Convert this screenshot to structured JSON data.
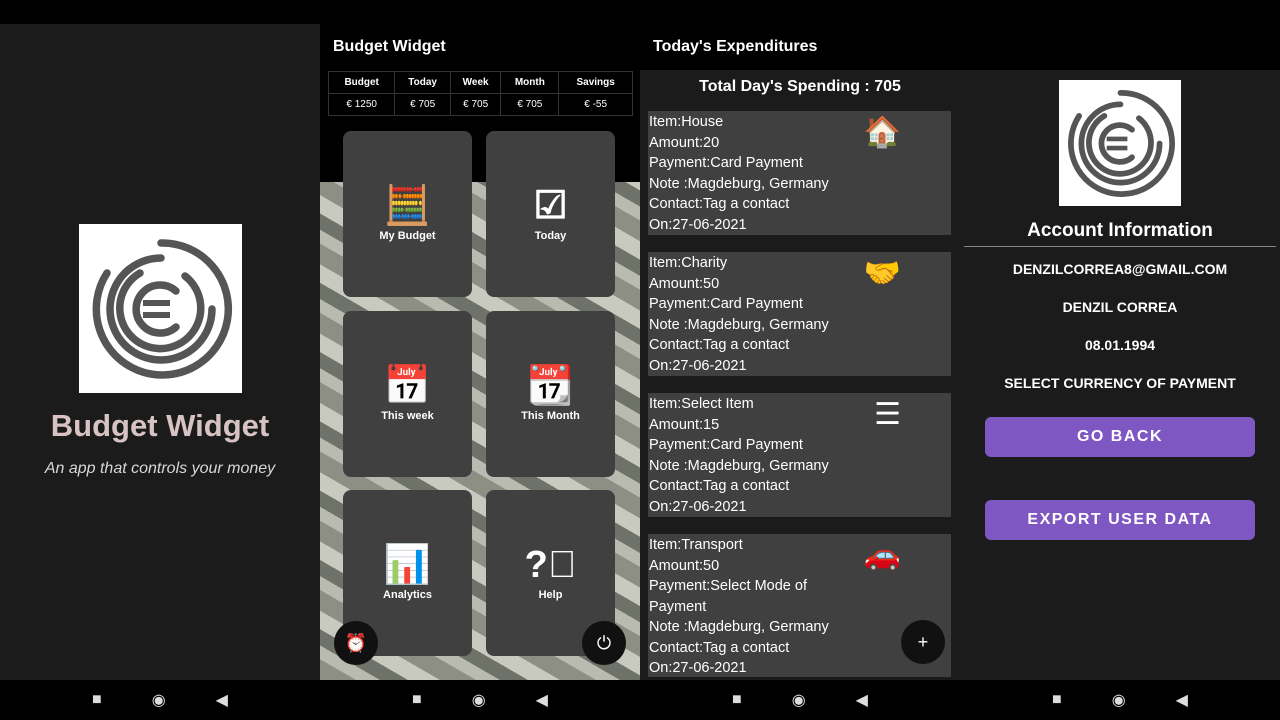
{
  "splash": {
    "title": "Budget Widget",
    "subtitle": "An app that controls your money"
  },
  "home": {
    "title": "Budget Widget",
    "summary_headers": [
      "Budget",
      "Today",
      "Week",
      "Month",
      "Savings"
    ],
    "summary_values": [
      "€ 1250",
      "€ 705",
      "€ 705",
      "€ 705",
      "€ -55"
    ],
    "tiles": [
      {
        "label": "My Budget",
        "icon": "calculator-icon"
      },
      {
        "label": "Today",
        "icon": "calendar-check-icon"
      },
      {
        "label": "This week",
        "icon": "calendar-7-icon"
      },
      {
        "label": "This Month",
        "icon": "calendar-31-icon"
      },
      {
        "label": "Analytics",
        "icon": "chart-icon"
      },
      {
        "label": "Help",
        "icon": "help-icon"
      }
    ]
  },
  "expenditures": {
    "title": "Today's Expenditures",
    "total": "Total Day's Spending : 705",
    "items": [
      {
        "lines": [
          "Item:House",
          "Amount:20",
          "Payment:Card Payment",
          "Note :Magdeburg, Germany",
          "Contact:Tag a contact",
          "On:27-06-2021"
        ],
        "icon": "house-icon"
      },
      {
        "lines": [
          "Item:Charity",
          "Amount:50",
          "Payment:Card Payment",
          "Note :Magdeburg, Germany",
          "Contact:Tag a contact",
          "On:27-06-2021"
        ],
        "icon": "handshake-icon"
      },
      {
        "lines": [
          "Item:Select Item",
          "Amount:15",
          "Payment:Card Payment",
          "Note :Magdeburg, Germany",
          "Contact:Tag a contact",
          "On:27-06-2021"
        ],
        "icon": "menu-lines-icon"
      },
      {
        "lines": [
          "Item:Transport",
          "Amount:50",
          "Payment:Select Mode of",
          "Payment",
          "Note :Magdeburg, Germany",
          "Contact:Tag a contact",
          "On:27-06-2021"
        ],
        "icon": "city-car-icon"
      }
    ]
  },
  "account": {
    "title": "Account Information",
    "email": "DENZILCORREA8@GMAIL.COM",
    "name": "DENZIL CORREA",
    "dob": "08.01.1994",
    "currency": "SELECT CURRENCY OF PAYMENT",
    "go_back": "GO BACK",
    "export": "EXPORT USER DATA",
    "accent": "#7e57c2"
  }
}
